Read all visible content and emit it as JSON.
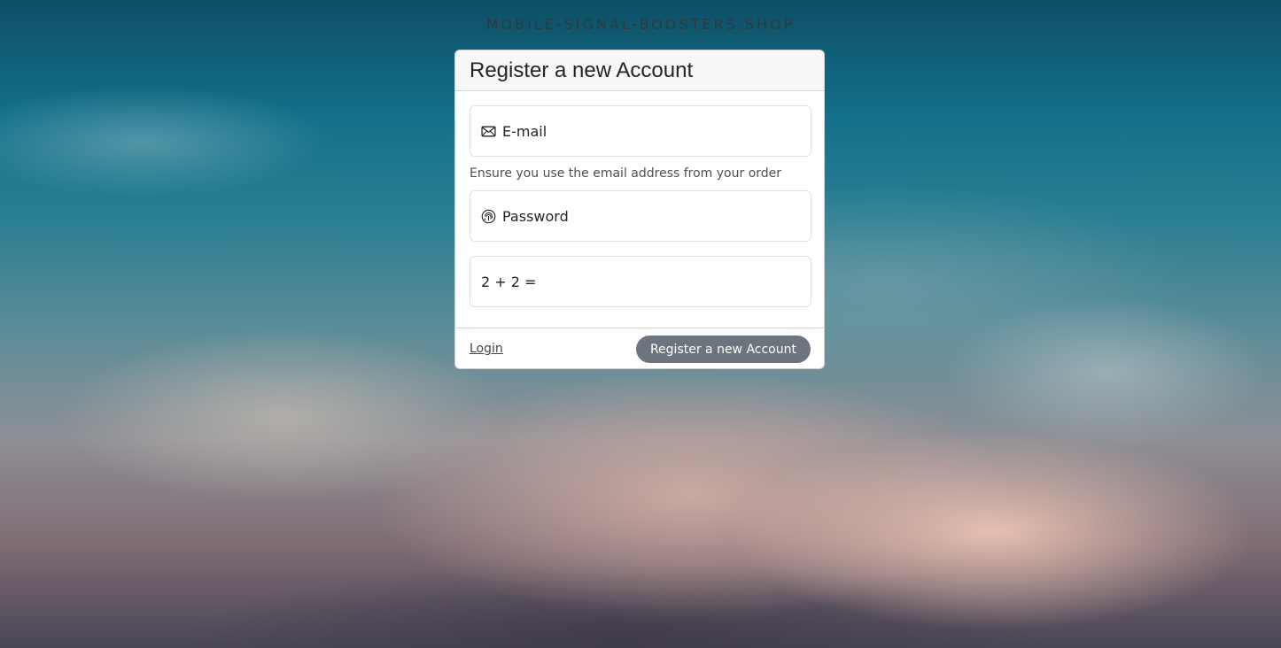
{
  "site": {
    "name": "MOBILE-SIGNAL-BOOSTERS.SHOP"
  },
  "form": {
    "title": "Register a new Account",
    "email": {
      "placeholder": "E-mail",
      "value": "",
      "icon": "envelope-icon",
      "hint": "Ensure you use the email address from your order"
    },
    "password": {
      "placeholder": "Password",
      "value": "",
      "icon": "fingerprint-icon"
    },
    "captcha": {
      "placeholder": "2 + 2 =",
      "value": ""
    },
    "login_link": "Login",
    "submit_label": "Register a new Account"
  },
  "colors": {
    "button": "#6c757d",
    "card_header": "#f7f7f7",
    "sky_top": "#0e4f66",
    "clouds": "#ecc4b4"
  }
}
